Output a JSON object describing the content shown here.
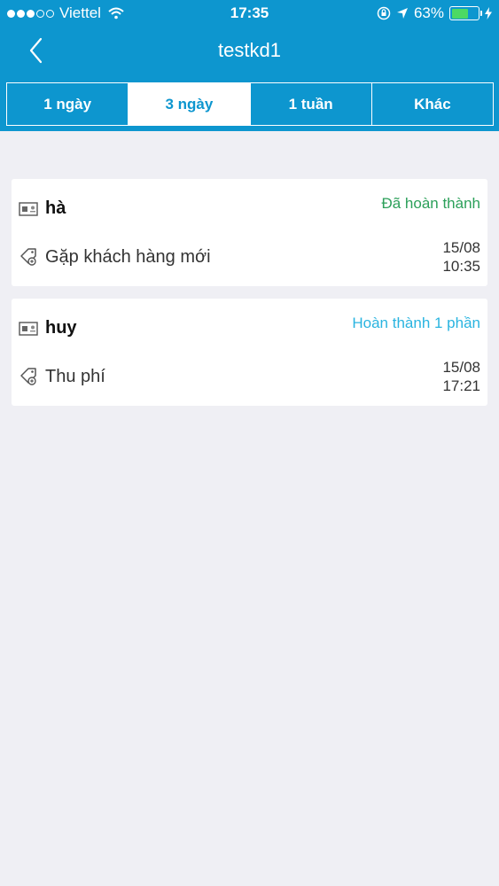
{
  "status_bar": {
    "carrier": "Viettel",
    "time": "17:35",
    "battery": "63%"
  },
  "nav": {
    "title": "testkd1"
  },
  "tabs": [
    {
      "label": "1 ngày"
    },
    {
      "label": "3 ngày"
    },
    {
      "label": "1 tuần"
    },
    {
      "label": "Khác"
    }
  ],
  "visits": [
    {
      "name": "hà",
      "status": "Đã hoàn thành",
      "task": "Gặp khách hàng mới",
      "date": "15/08",
      "time": "10:35"
    },
    {
      "name": "huy",
      "status": "Hoàn thành 1 phần",
      "task": "Thu phí",
      "date": "15/08",
      "time": "17:21"
    }
  ],
  "colors": {
    "header": "#0d96cf",
    "status_done": "#2ca05a",
    "status_partial": "#2ab4e0",
    "background": "#efeff4"
  }
}
